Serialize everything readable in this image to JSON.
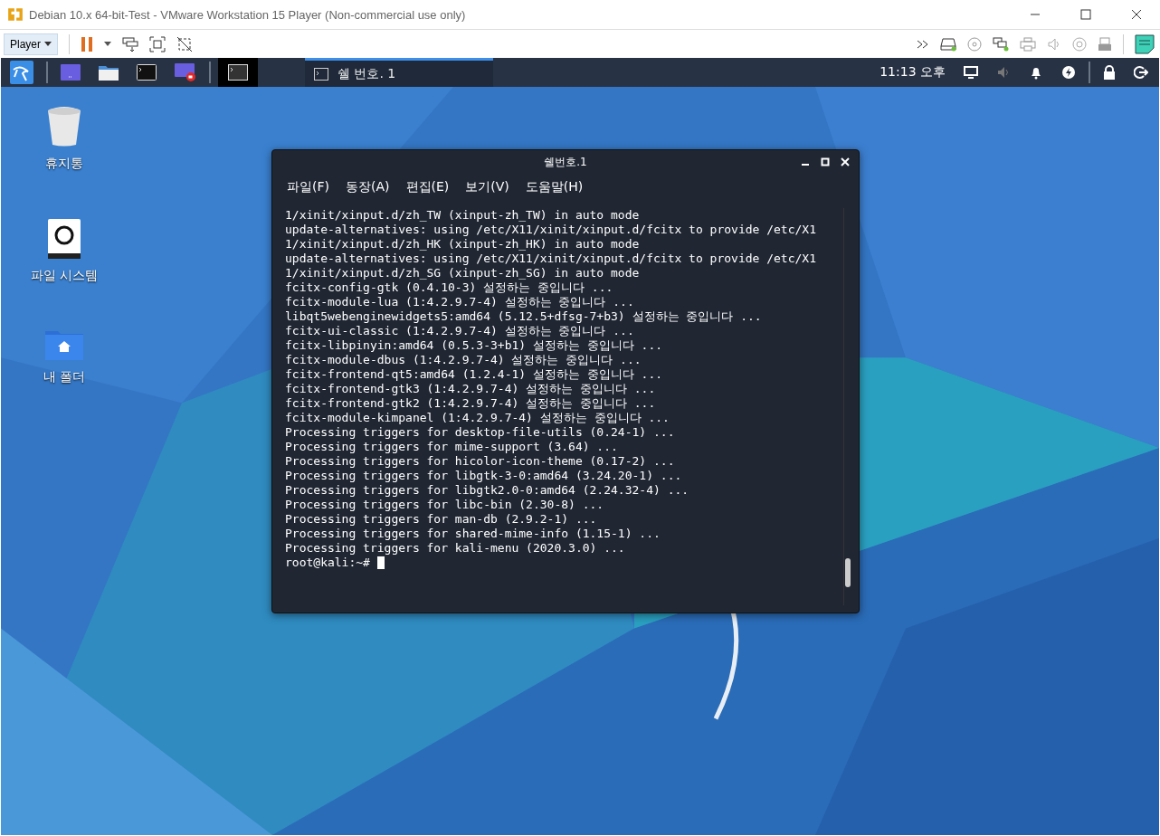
{
  "window": {
    "title": "Debian 10.x 64-bit-Test - VMware Workstation 15 Player (Non-commercial use only)"
  },
  "vm_toolbar": {
    "menu": "Player"
  },
  "guest_panel": {
    "tasks": [
      {
        "label": "쉘 번호. 1",
        "selected": true
      }
    ],
    "clock": "11:13 오후"
  },
  "desktop_icons": [
    {
      "label": "휴지통",
      "kind": "trash"
    },
    {
      "label": "파일 시스템",
      "kind": "drive"
    },
    {
      "label": "내 폴더",
      "kind": "home"
    }
  ],
  "terminal": {
    "title": "쉘번호.1",
    "menu": [
      "파일(F)",
      "동장(A)",
      "편집(E)",
      "보기(V)",
      "도움말(H)"
    ],
    "lines": [
      "1/xinit/xinput.d/zh_TW (xinput-zh_TW) in auto mode",
      "update-alternatives: using /etc/X11/xinit/xinput.d/fcitx to provide /etc/X1",
      "1/xinit/xinput.d/zh_HK (xinput-zh_HK) in auto mode",
      "update-alternatives: using /etc/X11/xinit/xinput.d/fcitx to provide /etc/X1",
      "1/xinit/xinput.d/zh_SG (xinput-zh_SG) in auto mode",
      "fcitx-config-gtk (0.4.10-3) 설정하는 중입니다 ...",
      "fcitx-module-lua (1:4.2.9.7-4) 설정하는 중입니다 ...",
      "libqt5webenginewidgets5:amd64 (5.12.5+dfsg-7+b3) 설정하는 중입니다 ...",
      "fcitx-ui-classic (1:4.2.9.7-4) 설정하는 중입니다 ...",
      "fcitx-libpinyin:amd64 (0.5.3-3+b1) 설정하는 중입니다 ...",
      "fcitx-module-dbus (1:4.2.9.7-4) 설정하는 중입니다 ...",
      "fcitx-frontend-qt5:amd64 (1.2.4-1) 설정하는 중입니다 ...",
      "fcitx-frontend-gtk3 (1:4.2.9.7-4) 설정하는 중입니다 ...",
      "fcitx-frontend-gtk2 (1:4.2.9.7-4) 설정하는 중입니다 ...",
      "fcitx-module-kimpanel (1:4.2.9.7-4) 설정하는 중입니다 ...",
      "Processing triggers for desktop-file-utils (0.24-1) ...",
      "Processing triggers for mime-support (3.64) ...",
      "Processing triggers for hicolor-icon-theme (0.17-2) ...",
      "Processing triggers for libgtk-3-0:amd64 (3.24.20-1) ...",
      "Processing triggers for libgtk2.0-0:amd64 (2.24.32-4) ...",
      "Processing triggers for libc-bin (2.30-8) ...",
      "Processing triggers for man-db (2.9.2-1) ...",
      "Processing triggers for shared-mime-info (1.15-1) ...",
      "Processing triggers for kali-menu (2020.3.0) ..."
    ],
    "prompt": "root@kali:~#"
  }
}
